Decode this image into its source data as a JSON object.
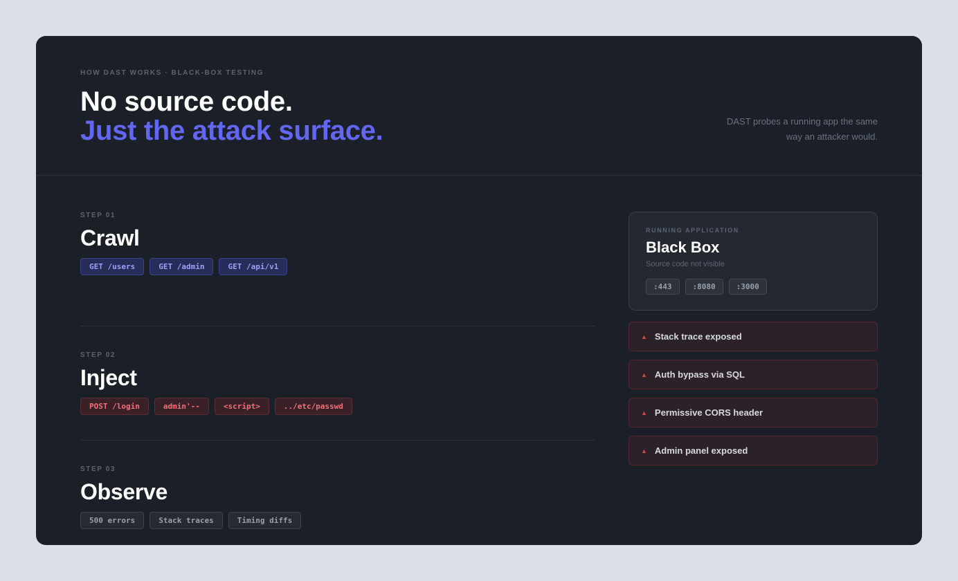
{
  "header": {
    "eyebrow": "HOW DAST WORKS · BLACK-BOX TESTING",
    "title_line1": "No source code.",
    "title_line2": "Just the attack surface.",
    "subtext_line1": "DAST probes a running app the same",
    "subtext_line2": "way an attacker would."
  },
  "steps": [
    {
      "label": "STEP 01",
      "title": "Crawl",
      "chips": [
        "GET /users",
        "GET /admin",
        "GET /api/v1"
      ]
    },
    {
      "label": "STEP 02",
      "title": "Inject",
      "chips": [
        "POST /login",
        "admin'--",
        "<script>",
        "../etc/passwd"
      ]
    },
    {
      "label": "STEP 03",
      "title": "Observe",
      "chips": [
        "500 errors",
        "Stack traces",
        "Timing diffs"
      ]
    }
  ],
  "app": {
    "eyebrow": "RUNNING APPLICATION",
    "title": "Black Box",
    "subtitle": "Source code not visible",
    "ports": [
      ":443",
      ":8080",
      ":3000"
    ]
  },
  "findings": [
    {
      "icon": "warning-triangle-icon",
      "label": "Stack trace exposed"
    },
    {
      "icon": "warning-triangle-icon",
      "label": "Auth bypass via SQL"
    },
    {
      "icon": "warning-triangle-icon",
      "label": "Permissive CORS header"
    },
    {
      "icon": "warning-triangle-icon",
      "label": "Admin panel exposed"
    }
  ],
  "colors": {
    "page_bg": "#dcdfe7",
    "card_bg": "#1b1f27",
    "accent": "#6366f1",
    "danger": "#d04848"
  }
}
